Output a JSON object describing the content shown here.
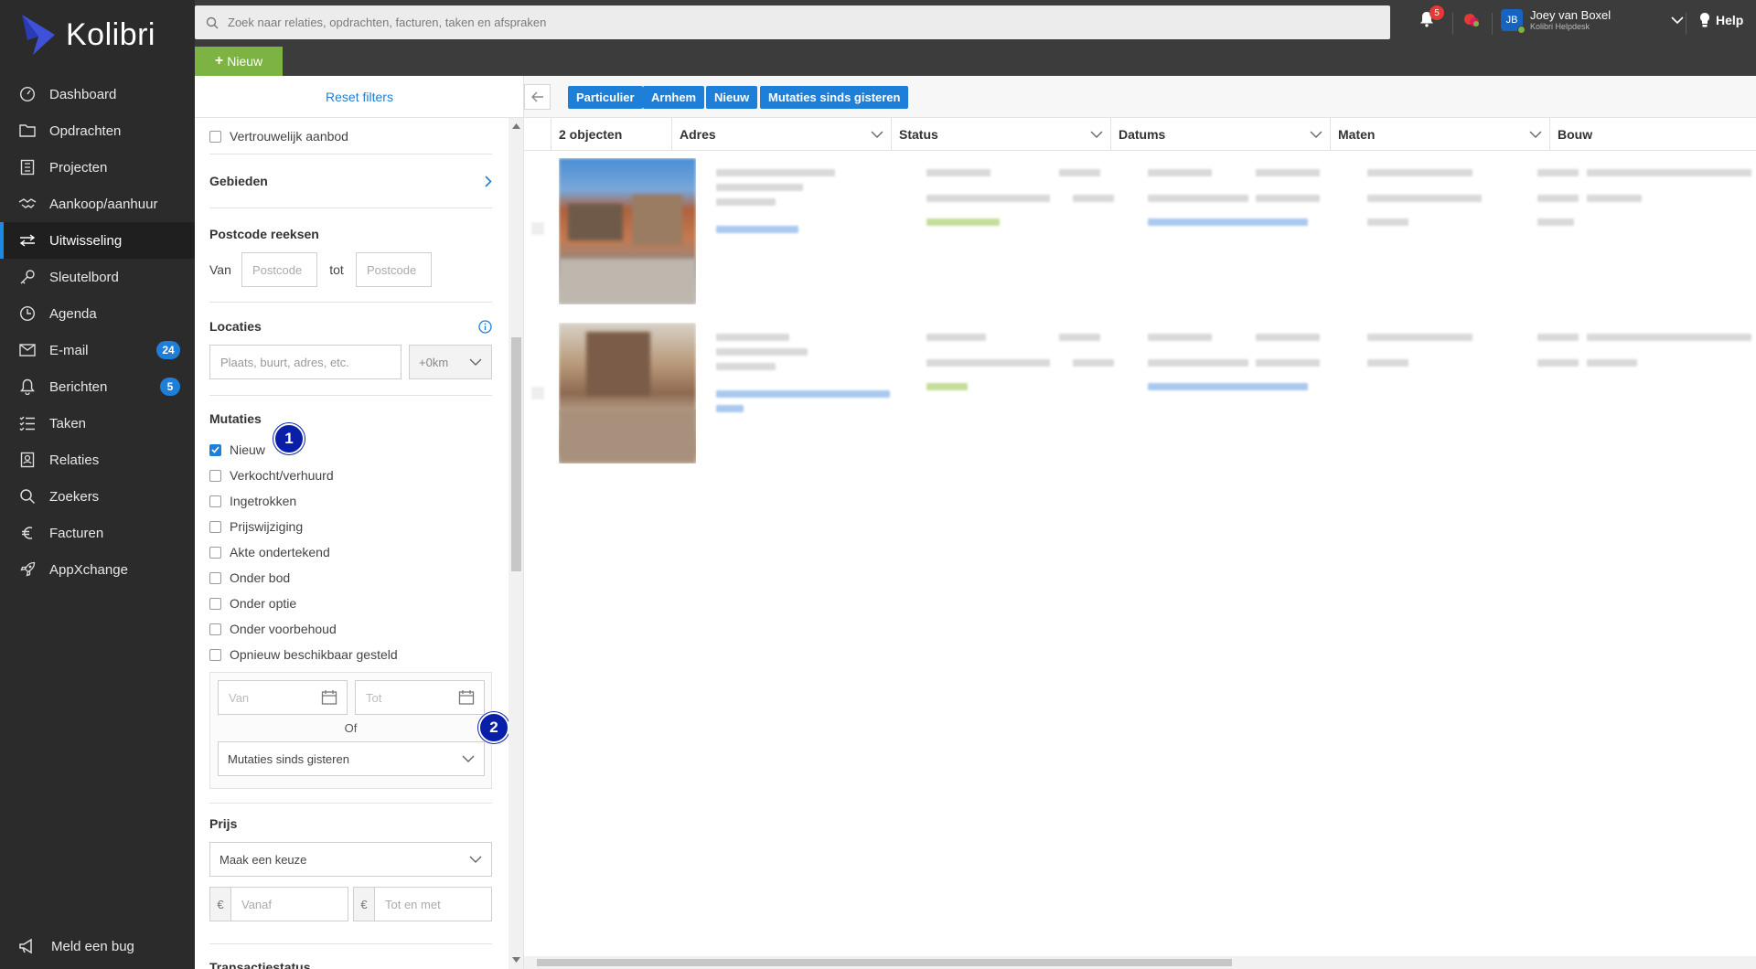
{
  "app": {
    "name": "Kolibri"
  },
  "colors": {
    "sidebar": "#2b2b2b",
    "accent": "#1e7fd8",
    "new_button": "#7cb342",
    "marker": "#0a1fa8"
  },
  "nav": {
    "items": [
      {
        "label": "Dashboard",
        "icon": "dashboard-icon"
      },
      {
        "label": "Opdrachten",
        "icon": "folder-icon"
      },
      {
        "label": "Projecten",
        "icon": "building-icon"
      },
      {
        "label": "Aankoop/aanhuur",
        "icon": "handshake-icon"
      },
      {
        "label": "Uitwisseling",
        "icon": "exchange-icon"
      },
      {
        "label": "Sleutelbord",
        "icon": "key-icon"
      },
      {
        "label": "Agenda",
        "icon": "calendar-icon"
      },
      {
        "label": "E-mail",
        "icon": "mail-icon",
        "badge": "24"
      },
      {
        "label": "Berichten",
        "icon": "bell-icon",
        "badge": "5"
      },
      {
        "label": "Taken",
        "icon": "tasks-icon"
      },
      {
        "label": "Relaties",
        "icon": "contacts-icon"
      },
      {
        "label": "Zoekers",
        "icon": "search-icon"
      },
      {
        "label": "Facturen",
        "icon": "euro-icon"
      },
      {
        "label": "AppXchange",
        "icon": "rocket-icon"
      }
    ],
    "active": "Uitwisseling",
    "bug_label": "Meld een bug"
  },
  "topbar": {
    "search_placeholder": "Zoek naar relaties, opdrachten, facturen, taken en afspraken",
    "new_label": "Nieuw",
    "notifications_count": "5",
    "user": {
      "initials": "JB",
      "name": "Joey van Boxel",
      "org": "Kolibri Helpdesk"
    },
    "help_label": "Help"
  },
  "filters": {
    "reset_label": "Reset filters",
    "confidential_label": "Vertrouwelijk aanbod",
    "areas_label": "Gebieden",
    "postcode": {
      "title": "Postcode reeksen",
      "from_label": "Van",
      "to_label": "tot",
      "placeholder": "Postcode"
    },
    "locations": {
      "title": "Locaties",
      "placeholder": "Plaats, buurt, adres, etc.",
      "radius": "+0km"
    },
    "mutations": {
      "title": "Mutaties",
      "options": [
        {
          "label": "Nieuw",
          "checked": true
        },
        {
          "label": "Verkocht/verhuurd",
          "checked": false
        },
        {
          "label": "Ingetrokken",
          "checked": false
        },
        {
          "label": "Prijswijziging",
          "checked": false
        },
        {
          "label": "Akte ondertekend",
          "checked": false
        },
        {
          "label": "Onder bod",
          "checked": false
        },
        {
          "label": "Onder optie",
          "checked": false
        },
        {
          "label": "Onder voorbehoud",
          "checked": false
        },
        {
          "label": "Opnieuw beschikbaar gesteld",
          "checked": false
        }
      ],
      "date_from_placeholder": "Van",
      "date_to_placeholder": "Tot",
      "or_label": "Of",
      "period_value": "Mutaties sinds gisteren"
    },
    "price": {
      "title": "Prijs",
      "choose": "Maak een keuze",
      "currency": "€",
      "from_placeholder": "Vanaf",
      "to_placeholder": "Tot en met"
    },
    "transaction_title": "Transactiestatus",
    "markers": [
      "1",
      "2"
    ]
  },
  "results": {
    "chips": [
      "Particulier",
      "Arnhem",
      "Nieuw",
      "Mutaties sinds gisteren"
    ],
    "columns": [
      "2 objecten",
      "Adres",
      "Status",
      "Datums",
      "Maten",
      "Bouw"
    ],
    "row_count": 2
  }
}
